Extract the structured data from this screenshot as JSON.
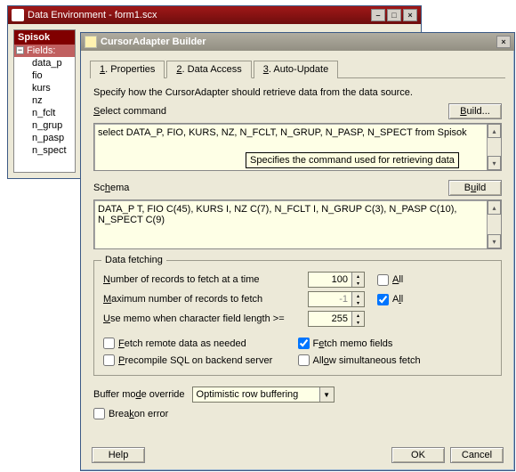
{
  "back_window": {
    "title": "Data Environment - form1.scx",
    "sidebar": {
      "header": "Spisok",
      "group": "Fields:",
      "items": [
        "data_p",
        "fio",
        "kurs",
        "nz",
        "n_fclt",
        "n_grup",
        "n_pasp",
        "n_spect"
      ]
    }
  },
  "dialog": {
    "title": "CursorAdapter Builder",
    "tabs": {
      "properties": "Properties",
      "data_access": "Data Access",
      "auto_update": "Auto-Update"
    },
    "intro": "Specify how the CursorAdapter should retrieve data from the data source.",
    "select_command": {
      "label": "Select command",
      "button": "Build...",
      "value": "select DATA_P, FIO, KURS, NZ, N_FCLT, N_GRUP, N_PASP, N_SPECT from Spisok",
      "tooltip": "Specifies the command used for retrieving data"
    },
    "schema": {
      "label": "Schema",
      "button": "Build",
      "value": "DATA_P T, FIO C(45), KURS I, NZ C(7), N_FCLT I, N_GRUP C(3), N_PASP C(10), N_SPECT C(9)"
    },
    "data_fetching": {
      "legend": "Data fetching",
      "num_records_label": "Number of records to fetch at a time",
      "num_records_value": "100",
      "num_records_all_checked": false,
      "max_records_label": "Maximum number of records to fetch",
      "max_records_value": "-1",
      "max_records_all_checked": true,
      "all_label": "All",
      "memo_len_label": "Use memo when character field length >=",
      "memo_len_value": "255",
      "fetch_remote_label": "Fetch remote data as needed",
      "fetch_remote_checked": false,
      "fetch_memo_label": "Fetch memo fields",
      "fetch_memo_checked": true,
      "precompile_label": "Precompile SQL on backend server",
      "precompile_checked": false,
      "allow_sim_label": "Allow simultaneous fetch",
      "allow_sim_checked": false
    },
    "buffer_mode": {
      "label": "Buffer mode override",
      "value": "Optimistic row buffering"
    },
    "break_on_error": {
      "label": "Break on error",
      "checked": false
    },
    "buttons": {
      "help": "Help",
      "ok": "OK",
      "cancel": "Cancel"
    }
  }
}
